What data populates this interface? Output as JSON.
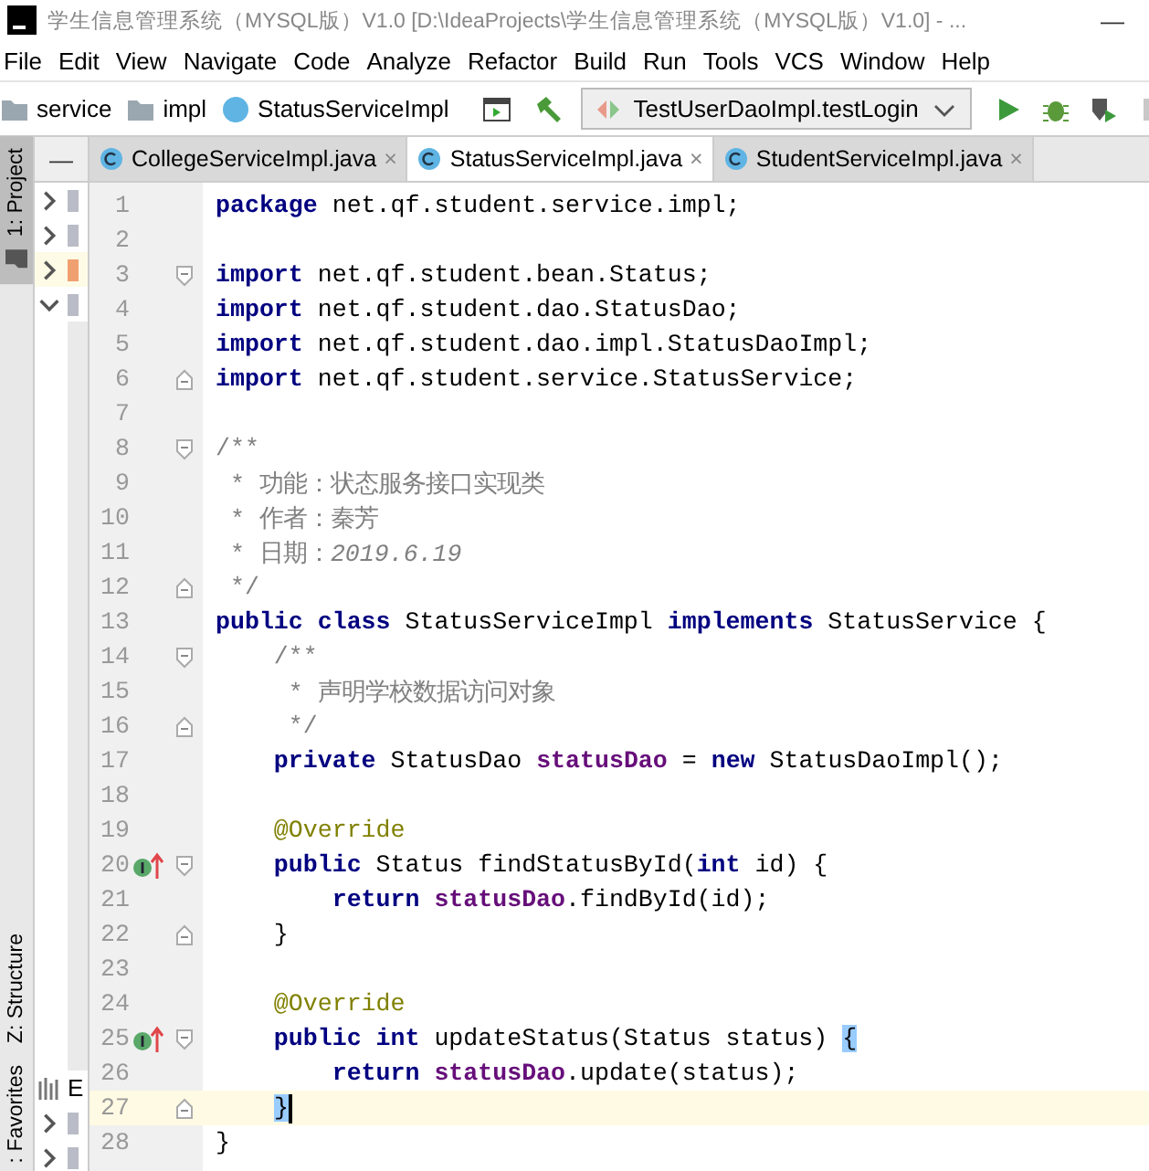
{
  "window": {
    "title": "学生信息管理系统（MYSQL版）V1.0 [D:\\IdeaProjects\\学生信息管理系统（MYSQL版）V1.0] - ...",
    "minimize": "—"
  },
  "menu": [
    "File",
    "Edit",
    "View",
    "Navigate",
    "Code",
    "Analyze",
    "Refactor",
    "Build",
    "Run",
    "Tools",
    "VCS",
    "Window",
    "Help"
  ],
  "breadcrumbs": [
    {
      "kind": "folder",
      "label": "service"
    },
    {
      "kind": "folder",
      "label": "impl"
    },
    {
      "kind": "class",
      "label": "StatusServiceImpl"
    }
  ],
  "run_config": {
    "label": "TestUserDaoImpl.testLogin"
  },
  "tool_strip": [
    {
      "label": "1: Project",
      "selected": true
    },
    {
      "label": "Z: Structure",
      "selected": false
    },
    {
      "label": ": Favorites",
      "selected": false
    }
  ],
  "project_panel": {
    "collapse": "—",
    "top_rows": [
      {
        "expanded": false,
        "selected": false
      },
      {
        "expanded": false,
        "selected": false
      },
      {
        "expanded": false,
        "selected": true
      },
      {
        "expanded": true,
        "selected": false
      }
    ],
    "bottom_label": "E",
    "bottom_rows": [
      {
        "expanded": false
      },
      {
        "expanded": false
      }
    ]
  },
  "tabs": [
    {
      "label": "CollegeServiceImpl.java",
      "close": "×",
      "selected": false
    },
    {
      "label": "StatusServiceImpl.java",
      "close": "×",
      "selected": true
    },
    {
      "label": "StudentServiceImpl.java",
      "close": "×",
      "selected": false
    }
  ],
  "editor": {
    "lines": [
      {
        "number": "1",
        "tokens": [
          {
            "kind": "keyword",
            "text": "package"
          },
          {
            "kind": "plain",
            "text": " net.qf.student.service.impl;"
          }
        ]
      },
      {
        "number": "2"
      },
      {
        "number": "3",
        "fold_start": true,
        "tokens": [
          {
            "kind": "keyword",
            "text": "import"
          },
          {
            "kind": "plain",
            "text": " net.qf.student.bean.Status;"
          }
        ]
      },
      {
        "number": "4",
        "tokens": [
          {
            "kind": "keyword",
            "text": "import"
          },
          {
            "kind": "plain",
            "text": " net.qf.student.dao.StatusDao;"
          }
        ]
      },
      {
        "number": "5",
        "tokens": [
          {
            "kind": "keyword",
            "text": "import"
          },
          {
            "kind": "plain",
            "text": " net.qf.student.dao.impl.StatusDaoImpl;"
          }
        ]
      },
      {
        "number": "6",
        "fold_end": true,
        "tokens": [
          {
            "kind": "keyword",
            "text": "import"
          },
          {
            "kind": "plain",
            "text": " net.qf.student.service.StatusService;"
          }
        ]
      },
      {
        "number": "7"
      },
      {
        "number": "8",
        "fold_start": true,
        "tokens": [
          {
            "kind": "comment",
            "text": "/**"
          }
        ]
      },
      {
        "number": "9",
        "tokens": [
          {
            "kind": "comment",
            "text": " * 功能：状态服务接口实现类"
          }
        ]
      },
      {
        "number": "10",
        "tokens": [
          {
            "kind": "comment",
            "text": " * 作者：秦芳"
          }
        ]
      },
      {
        "number": "11",
        "tokens": [
          {
            "kind": "comment",
            "text": " * 日期："
          },
          {
            "kind": "doc-value",
            "text": "2019.6.19"
          }
        ]
      },
      {
        "number": "12",
        "fold_end": true,
        "tokens": [
          {
            "kind": "comment",
            "text": " */"
          }
        ]
      },
      {
        "number": "13",
        "tokens": [
          {
            "kind": "keyword",
            "text": "public class"
          },
          {
            "kind": "plain",
            "text": " StatusServiceImpl "
          },
          {
            "kind": "keyword",
            "text": "implements"
          },
          {
            "kind": "plain",
            "text": " StatusService {"
          }
        ]
      },
      {
        "number": "14",
        "fold_start": true,
        "tokens": [
          {
            "kind": "comment",
            "text": "    /**"
          }
        ]
      },
      {
        "number": "15",
        "tokens": [
          {
            "kind": "comment",
            "text": "     * 声明学校数据访问对象"
          }
        ]
      },
      {
        "number": "16",
        "fold_end": true,
        "tokens": [
          {
            "kind": "comment",
            "text": "     */"
          }
        ]
      },
      {
        "number": "17",
        "tokens": [
          {
            "kind": "keyword",
            "text": "    private"
          },
          {
            "kind": "plain",
            "text": " StatusDao "
          },
          {
            "kind": "field",
            "text": "statusDao"
          },
          {
            "kind": "plain",
            "text": " = "
          },
          {
            "kind": "keyword",
            "text": "new"
          },
          {
            "kind": "plain",
            "text": " StatusDaoImpl();"
          }
        ]
      },
      {
        "number": "18"
      },
      {
        "number": "19",
        "tokens": [
          {
            "kind": "annotation",
            "text": "    @Override"
          }
        ]
      },
      {
        "number": "20",
        "implements_marker": true,
        "fold_start": true,
        "tokens": [
          {
            "kind": "keyword",
            "text": "    public"
          },
          {
            "kind": "plain",
            "text": " Status findStatusById("
          },
          {
            "kind": "keyword",
            "text": "int"
          },
          {
            "kind": "plain",
            "text": " id) {"
          }
        ]
      },
      {
        "number": "21",
        "tokens": [
          {
            "kind": "keyword",
            "text": "        return"
          },
          {
            "kind": "field",
            "text": " statusDao"
          },
          {
            "kind": "plain",
            "text": ".findById(id);"
          }
        ]
      },
      {
        "number": "22",
        "fold_end": true,
        "tokens": [
          {
            "kind": "plain",
            "text": "    }"
          }
        ]
      },
      {
        "number": "23"
      },
      {
        "number": "24",
        "tokens": [
          {
            "kind": "annotation",
            "text": "    @Override"
          }
        ]
      },
      {
        "number": "25",
        "implements_marker": true,
        "fold_start": true,
        "tokens": [
          {
            "kind": "keyword",
            "text": "    public int"
          },
          {
            "kind": "plain",
            "text": " updateStatus(Status status) "
          },
          {
            "kind": "brace-match",
            "text": "{"
          }
        ]
      },
      {
        "number": "26",
        "tokens": [
          {
            "kind": "keyword",
            "text": "        return"
          },
          {
            "kind": "field",
            "text": " statusDao"
          },
          {
            "kind": "plain",
            "text": ".update(status);"
          }
        ]
      },
      {
        "number": "27",
        "current": true,
        "fold_end": true,
        "tokens": [
          {
            "kind": "brace-match",
            "text": "}"
          }
        ],
        "indented": true
      },
      {
        "number": "28",
        "tokens": [
          {
            "kind": "plain",
            "text": "}"
          }
        ]
      }
    ]
  }
}
